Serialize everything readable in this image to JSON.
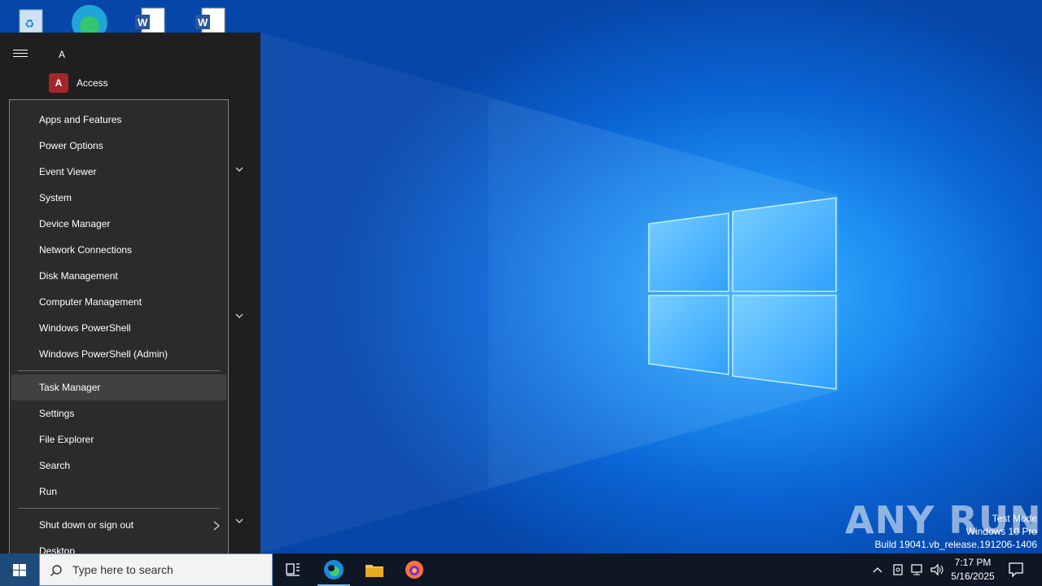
{
  "start_menu": {
    "section_letter": "A",
    "apps": [
      {
        "label": "Access",
        "icon": "access-icon"
      }
    ]
  },
  "context_menu": {
    "groups": [
      [
        "Apps and Features",
        "Power Options",
        "Event Viewer",
        "System",
        "Device Manager",
        "Network Connections",
        "Disk Management",
        "Computer Management",
        "Windows PowerShell",
        "Windows PowerShell (Admin)"
      ],
      [
        "Task Manager",
        "Settings",
        "File Explorer",
        "Search",
        "Run"
      ],
      [
        "Shut down or sign out",
        "Desktop"
      ]
    ],
    "hovered": "Task Manager",
    "submenu_item": "Shut down or sign out"
  },
  "taskbar": {
    "search_placeholder": "Type here to search",
    "pinned": [
      "task-view-icon",
      "edge-icon",
      "file-explorer-icon",
      "firefox-icon"
    ],
    "active": "edge-icon",
    "time": "7:17 PM",
    "date": "5/16/2025"
  },
  "watermark": {
    "logo": "ANY RUN",
    "line1": "Test Mode",
    "line2": "Windows 10 Pro",
    "line3": "Build 19041.vb_release.191206-1406"
  },
  "colors": {
    "menu_bg": "#2b2b2b",
    "menu_hover": "#414141",
    "start_bg": "#1f1f1f",
    "taskbar_bg": "#0f1724"
  }
}
